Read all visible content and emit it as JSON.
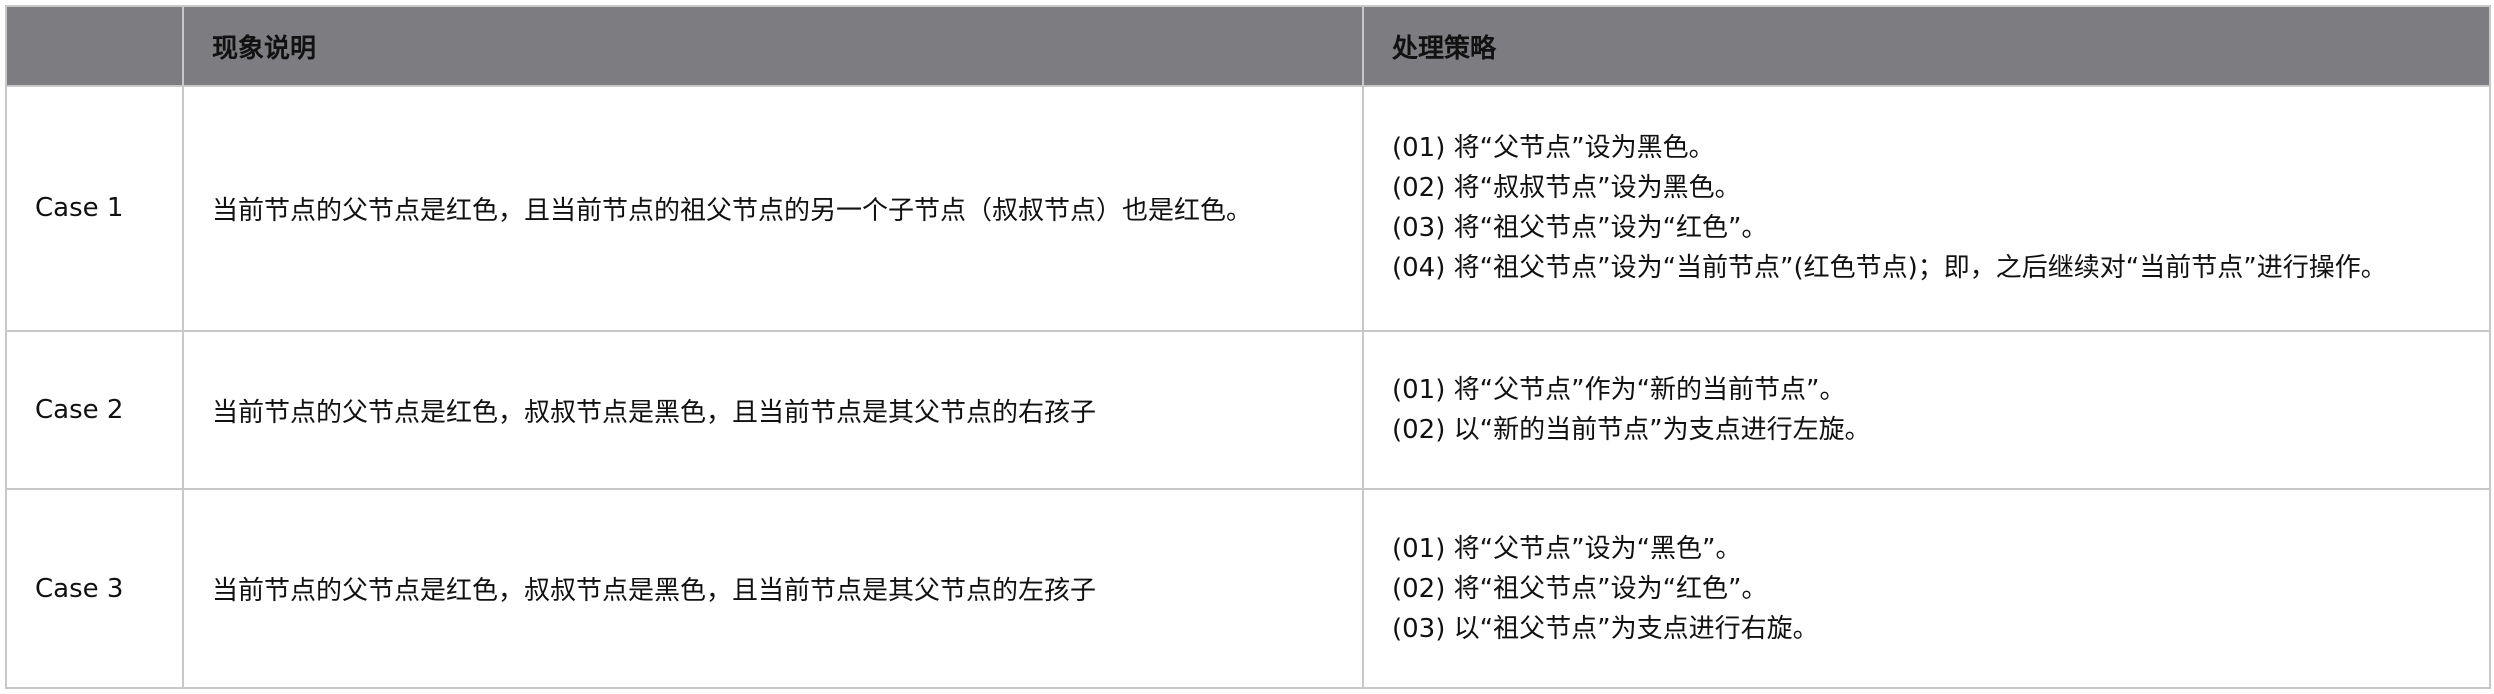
{
  "table": {
    "headers": [
      "",
      "现象说明",
      "处理策略"
    ],
    "rows": [
      {
        "case": "Case 1",
        "description": "当前节点的父节点是红色，且当前节点的祖父节点的另一个子节点（叔叔节点）也是红色。",
        "steps": [
          "(01) 将“父节点”设为黑色。",
          "(02) 将“叔叔节点”设为黑色。",
          "(03) 将“祖父节点”设为“红色”。",
          "(04) 将“祖父节点”设为“当前节点”(红色节点)；即，之后继续对“当前节点”进行操作。"
        ]
      },
      {
        "case": "Case 2",
        "description": "当前节点的父节点是红色，叔叔节点是黑色，且当前节点是其父节点的右孩子",
        "steps": [
          "(01) 将“父节点”作为“新的当前节点”。",
          "(02) 以“新的当前节点”为支点进行左旋。"
        ]
      },
      {
        "case": "Case 3",
        "description": "当前节点的父节点是红色，叔叔节点是黑色，且当前节点是其父节点的左孩子",
        "steps": [
          "(01) 将“父节点”设为“黑色”。",
          "(02) 将“祖父节点”设为“红色”。",
          "(03) 以“祖父节点”为支点进行右旋。"
        ]
      }
    ]
  },
  "colors": {
    "header_background": "#7d7c80",
    "border": "#c8c8c8",
    "text": "#111111"
  }
}
